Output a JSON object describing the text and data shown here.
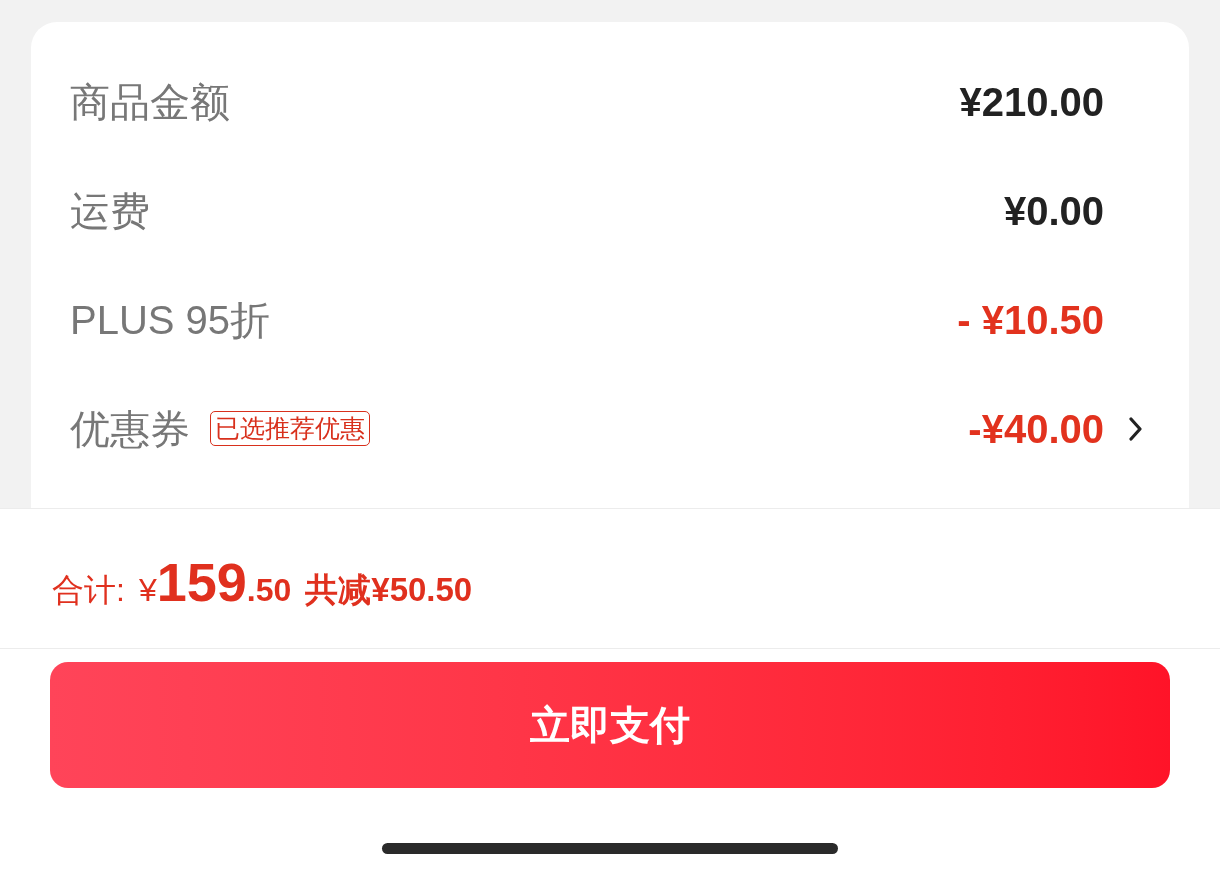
{
  "summary": {
    "rows": [
      {
        "kind": "charge",
        "label": "商品金额",
        "value": "¥210.00"
      },
      {
        "kind": "charge",
        "label": "运费",
        "value": "¥0.00"
      },
      {
        "kind": "discount",
        "label": "PLUS 95折",
        "value": "- ¥10.50"
      },
      {
        "kind": "coupon",
        "label": "优惠券",
        "tag": "已选推荐优惠",
        "value": "-¥40.00"
      }
    ]
  },
  "total": {
    "label": "合计:",
    "currency": "¥",
    "whole": "159",
    "fraction": ".50",
    "savings": "共减¥50.50"
  },
  "pay_button": {
    "label": "立即支付"
  }
}
